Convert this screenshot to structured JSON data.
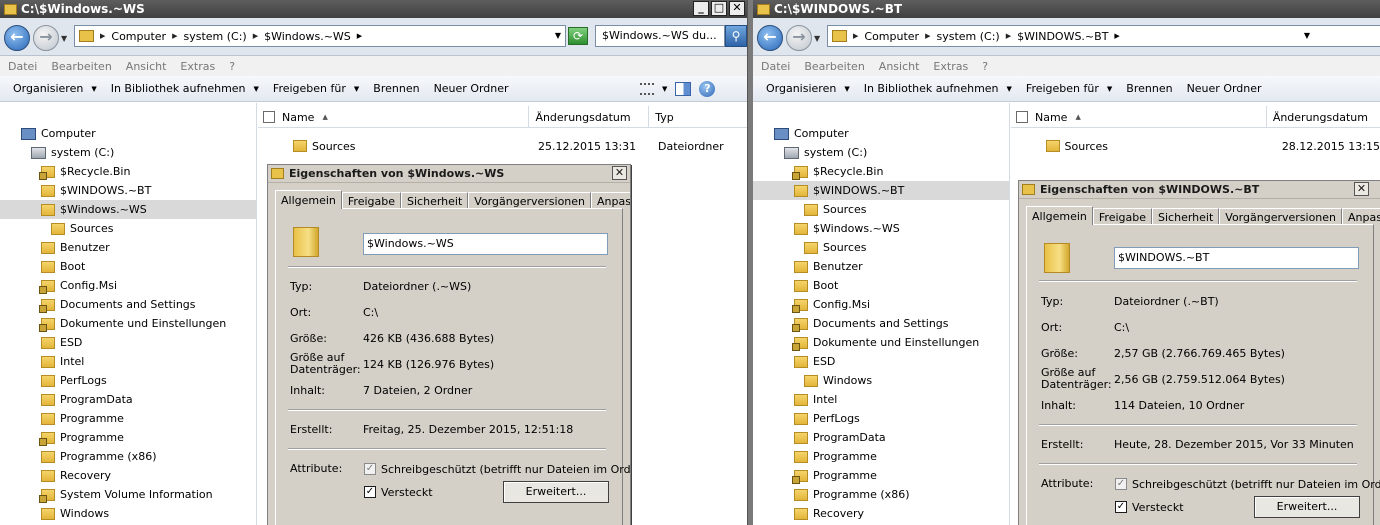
{
  "left": {
    "title": "C:\\$Windows.~WS",
    "breadcrumb": [
      "Computer",
      "system (C:)",
      "$Windows.~WS"
    ],
    "search_text": "$Windows.~WS du...",
    "menu": [
      "Datei",
      "Bearbeiten",
      "Ansicht",
      "Extras",
      "?"
    ],
    "toolbar": [
      "Organisieren",
      "In Bibliothek aufnehmen",
      "Freigeben für",
      "Brennen",
      "Neuer Ordner"
    ],
    "tree": [
      {
        "label": "Computer",
        "icon": "computer-icon"
      },
      {
        "label": "system (C:)",
        "icon": "drive-icon"
      },
      {
        "label": "$Recycle.Bin",
        "icon": "locked-folder-icon"
      },
      {
        "label": "$WINDOWS.~BT",
        "icon": "folder-icon"
      },
      {
        "label": "$Windows.~WS",
        "icon": "folder-icon",
        "selected": true
      },
      {
        "label": "Sources",
        "icon": "folder-icon"
      },
      {
        "label": "Benutzer",
        "icon": "folder-icon"
      },
      {
        "label": "Boot",
        "icon": "folder-icon"
      },
      {
        "label": "Config.Msi",
        "icon": "locked-folder-icon"
      },
      {
        "label": "Documents and Settings",
        "icon": "locked-folder-icon"
      },
      {
        "label": "Dokumente und Einstellungen",
        "icon": "locked-folder-icon"
      },
      {
        "label": "ESD",
        "icon": "folder-icon"
      },
      {
        "label": "Intel",
        "icon": "folder-icon"
      },
      {
        "label": "PerfLogs",
        "icon": "folder-icon"
      },
      {
        "label": "ProgramData",
        "icon": "folder-icon"
      },
      {
        "label": "Programme",
        "icon": "folder-icon"
      },
      {
        "label": "Programme",
        "icon": "locked-folder-icon"
      },
      {
        "label": "Programme (x86)",
        "icon": "folder-icon"
      },
      {
        "label": "Recovery",
        "icon": "folder-icon"
      },
      {
        "label": "System Volume Information",
        "icon": "locked-folder-icon"
      },
      {
        "label": "Windows",
        "icon": "folder-icon"
      }
    ],
    "columns": [
      "Name",
      "Änderungsdatum",
      "Typ"
    ],
    "files": [
      {
        "name": "Sources",
        "date": "25.12.2015 13:31",
        "type": "Dateiordner"
      }
    ],
    "dialog": {
      "title": "Eigenschaften von $Windows.~WS",
      "tabs": [
        "Allgemein",
        "Freigabe",
        "Sicherheit",
        "Vorgängerversionen",
        "Anpassen"
      ],
      "name": "$Windows.~WS",
      "type_label": "Typ:",
      "type_value": "Dateiordner (.~WS)",
      "loc_label": "Ort:",
      "loc_value": "C:\\",
      "size_label": "Größe:",
      "size_value": "426 KB (436.688 Bytes)",
      "disk_label_1": "Größe auf",
      "disk_label_2": "Datenträger:",
      "disk_value": "124 KB (126.976 Bytes)",
      "content_label": "Inhalt:",
      "content_value": "7 Dateien, 2 Ordner",
      "created_label": "Erstellt:",
      "created_value": "Freitag, 25. Dezember 2015, 12:51:18",
      "attr_label": "Attribute:",
      "readonly_label": "Schreibgeschützt (betrifft nur Dateien im Ordner)",
      "hidden_label": "Versteckt",
      "advanced_label": "Erweitert..."
    }
  },
  "right": {
    "title": "C:\\$WINDOWS.~BT",
    "breadcrumb": [
      "Computer",
      "system (C:)",
      "$WINDOWS.~BT"
    ],
    "menu": [
      "Datei",
      "Bearbeiten",
      "Ansicht",
      "Extras",
      "?"
    ],
    "toolbar": [
      "Organisieren",
      "In Bibliothek aufnehmen",
      "Freigeben für",
      "Brennen",
      "Neuer Ordner"
    ],
    "tree": [
      {
        "label": "Computer",
        "icon": "computer-icon"
      },
      {
        "label": "system (C:)",
        "icon": "drive-icon"
      },
      {
        "label": "$Recycle.Bin",
        "icon": "locked-folder-icon"
      },
      {
        "label": "$WINDOWS.~BT",
        "icon": "folder-icon",
        "selected": true
      },
      {
        "label": "Sources",
        "icon": "folder-icon"
      },
      {
        "label": "$Windows.~WS",
        "icon": "folder-icon"
      },
      {
        "label": "Sources",
        "icon": "folder-icon"
      },
      {
        "label": "Benutzer",
        "icon": "folder-icon"
      },
      {
        "label": "Boot",
        "icon": "folder-icon"
      },
      {
        "label": "Config.Msi",
        "icon": "locked-folder-icon"
      },
      {
        "label": "Documents and Settings",
        "icon": "locked-folder-icon"
      },
      {
        "label": "Dokumente und Einstellungen",
        "icon": "locked-folder-icon"
      },
      {
        "label": "ESD",
        "icon": "folder-icon"
      },
      {
        "label": "Windows",
        "icon": "folder-icon"
      },
      {
        "label": "Intel",
        "icon": "folder-icon"
      },
      {
        "label": "PerfLogs",
        "icon": "folder-icon"
      },
      {
        "label": "ProgramData",
        "icon": "folder-icon"
      },
      {
        "label": "Programme",
        "icon": "folder-icon"
      },
      {
        "label": "Programme",
        "icon": "locked-folder-icon"
      },
      {
        "label": "Programme (x86)",
        "icon": "folder-icon"
      },
      {
        "label": "Recovery",
        "icon": "folder-icon"
      }
    ],
    "columns": [
      "Name",
      "Änderungsdatum"
    ],
    "files": [
      {
        "name": "Sources",
        "date": "28.12.2015 13:15"
      }
    ],
    "dialog": {
      "title": "Eigenschaften von $WINDOWS.~BT",
      "tabs": [
        "Allgemein",
        "Freigabe",
        "Sicherheit",
        "Vorgängerversionen",
        "Anpassen"
      ],
      "name": "$WINDOWS.~BT",
      "type_label": "Typ:",
      "type_value": "Dateiordner (.~BT)",
      "loc_label": "Ort:",
      "loc_value": "C:\\",
      "size_label": "Größe:",
      "size_value": "2,57 GB (2.766.769.465 Bytes)",
      "disk_label_1": "Größe auf",
      "disk_label_2": "Datenträger:",
      "disk_value": "2,56 GB (2.759.512.064 Bytes)",
      "content_label": "Inhalt:",
      "content_value": "114 Dateien, 10 Ordner",
      "created_label": "Erstellt:",
      "created_value": "Heute, 28. Dezember 2015, Vor 33 Minuten",
      "attr_label": "Attribute:",
      "readonly_label": "Schreibgeschützt (betrifft nur Dateien im Ordner)",
      "hidden_label": "Versteckt",
      "advanced_label": "Erweitert..."
    }
  }
}
